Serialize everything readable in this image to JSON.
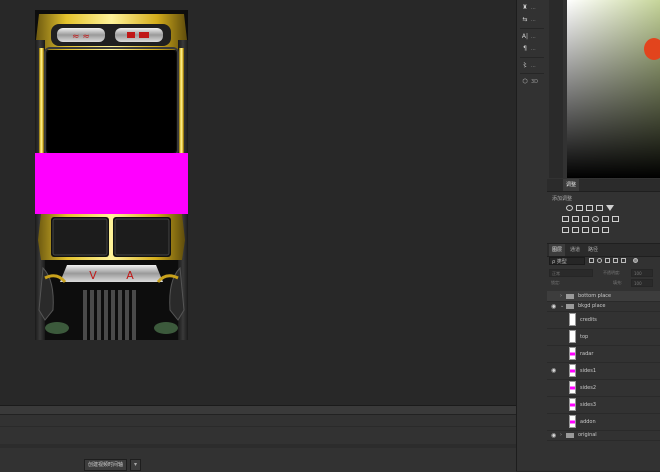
{
  "timeline": {
    "create_button": "创建视频时间轴"
  },
  "toolstrip": {
    "tools": [
      {
        "icon": "brush-preset-icon",
        "glyph": "♜",
        "label": "..."
      },
      {
        "icon": "clone-source-icon",
        "glyph": "⇆",
        "label": "..."
      },
      {
        "icon": "character-icon",
        "glyph": "A|",
        "label": "..."
      },
      {
        "icon": "paragraph-icon",
        "glyph": "¶",
        "label": "..."
      },
      {
        "icon": "glyph-icon",
        "glyph": "〻",
        "label": "..."
      },
      {
        "icon": "3d-icon",
        "glyph": "⬡",
        "label": "3D"
      }
    ]
  },
  "adjustments": {
    "tabs": [
      "",
      "调整"
    ],
    "add_label": "添加调整"
  },
  "layers_panel": {
    "tabs": [
      "图层",
      "通道",
      "路径"
    ],
    "kind_label": "ρ 类型",
    "blend_mode": "正常",
    "opacity_label": "不透明度:",
    "opacity_value": "100",
    "lock_label": "锁定:",
    "fill_label": "填充:",
    "fill_value": "100",
    "layers": [
      {
        "name": "bottom place",
        "type": "folder",
        "visible": false,
        "selected": true
      },
      {
        "name": "bkgd place",
        "type": "folder",
        "visible": true,
        "selected": false
      },
      {
        "name": "credits",
        "type": "layer",
        "visible": false,
        "thumb": "white"
      },
      {
        "name": "top",
        "type": "layer",
        "visible": false,
        "thumb": "white"
      },
      {
        "name": "radar",
        "type": "layer",
        "visible": false,
        "thumb": "pink"
      },
      {
        "name": "sides1",
        "type": "layer",
        "visible": true,
        "thumb": "pink"
      },
      {
        "name": "sides2",
        "type": "layer",
        "visible": false,
        "thumb": "pink"
      },
      {
        "name": "sides3",
        "type": "layer",
        "visible": false,
        "thumb": "pink"
      },
      {
        "name": "addon",
        "type": "layer",
        "visible": false,
        "thumb": "pink"
      },
      {
        "name": "original",
        "type": "folder",
        "visible": true,
        "selected": false
      }
    ]
  },
  "colors": {
    "magenta": "#ff00ff",
    "gold": "#c9a21c",
    "chrome": "#b9b9b9",
    "logo_red": "#e2441d"
  }
}
